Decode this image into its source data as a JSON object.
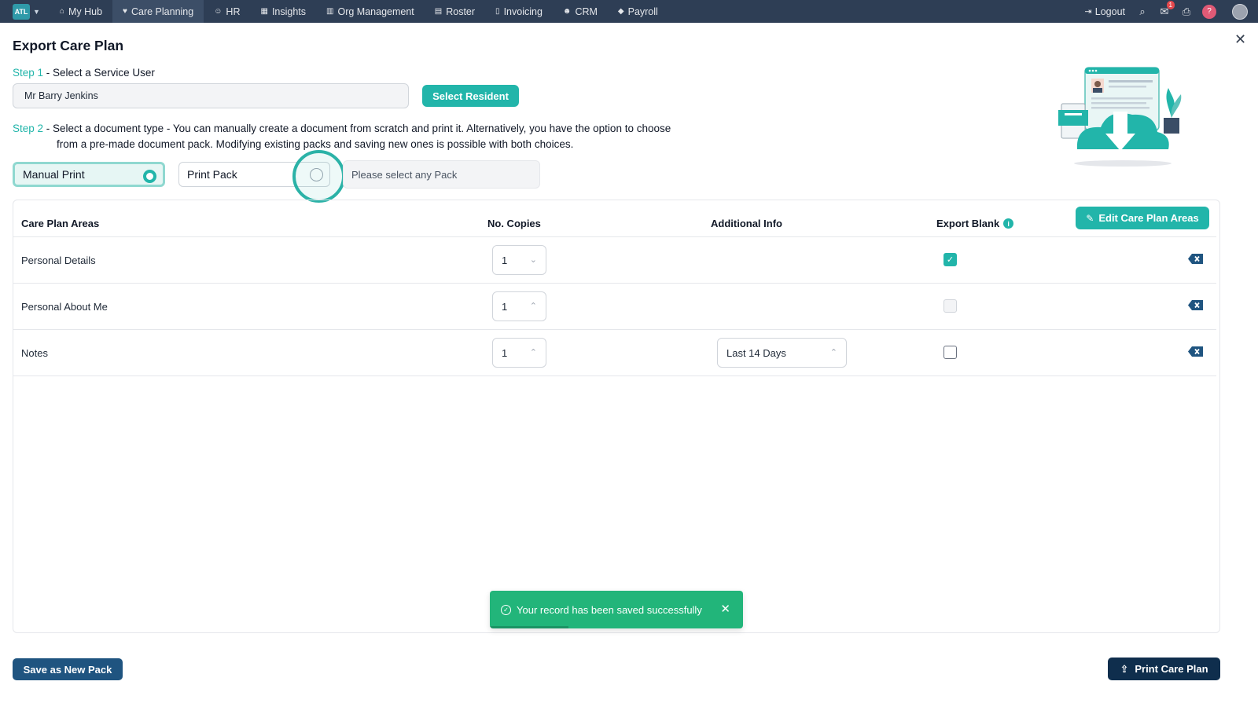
{
  "nav": {
    "brand": "ATL",
    "items": [
      {
        "label": "My Hub",
        "icon": "home-icon",
        "glyph": "⌂",
        "active": false
      },
      {
        "label": "Care Planning",
        "icon": "heart-icon",
        "glyph": "♥",
        "active": true
      },
      {
        "label": "HR",
        "icon": "users-icon",
        "glyph": "☺",
        "active": false
      },
      {
        "label": "Insights",
        "icon": "chart-icon",
        "glyph": "▦",
        "active": false
      },
      {
        "label": "Org Management",
        "icon": "building-icon",
        "glyph": "▥",
        "active": false
      },
      {
        "label": "Roster",
        "icon": "calendar-icon",
        "glyph": "▤",
        "active": false
      },
      {
        "label": "Invoicing",
        "icon": "document-icon",
        "glyph": "▯",
        "active": false
      },
      {
        "label": "CRM",
        "icon": "contacts-icon",
        "glyph": "☻",
        "active": false
      },
      {
        "label": "Payroll",
        "icon": "tag-icon",
        "glyph": "◆",
        "active": false
      }
    ],
    "logout": "Logout",
    "notification_count": "1"
  },
  "page": {
    "title": "Export Care Plan",
    "step1_label": "Step 1",
    "step1_text": " - Select a Service User",
    "resident_value": "Mr Barry Jenkins",
    "select_resident_button": "Select Resident",
    "step2_label": "Step 2",
    "step2_sub": " - Select a document type - ",
    "step2_text": "You can manually create a document from scratch and print it. Alternatively, you have the option to choose",
    "step2_text_2": "from a pre-made document pack. Modifying existing packs and saving new ones is possible with both choices.",
    "option_manual": "Manual Print",
    "option_pack": "Print Pack",
    "pack_placeholder": "Please select any Pack"
  },
  "table": {
    "headers": {
      "areas": "Care Plan Areas",
      "copies": "No. Copies",
      "info": "Additional Info",
      "blank": "Export Blank"
    },
    "edit_button": "Edit Care Plan Areas",
    "rows": [
      {
        "area": "Personal Details",
        "copies": "1",
        "info": "",
        "blank": "checked"
      },
      {
        "area": "Personal About Me",
        "copies": "1",
        "info": "",
        "blank": "disabled"
      },
      {
        "area": "Notes",
        "copies": "1",
        "info": "Last 14 Days",
        "blank": "unchecked"
      }
    ]
  },
  "toast": {
    "message": "Your record has been saved successfully"
  },
  "footer": {
    "save_pack_button": "Save as New Pack",
    "print_button": "Print Care Plan"
  },
  "colors": {
    "accent": "#22b5aa",
    "navbar": "#2e3e55",
    "toast": "#22b57a",
    "primary_dark": "#0f2e4d"
  }
}
